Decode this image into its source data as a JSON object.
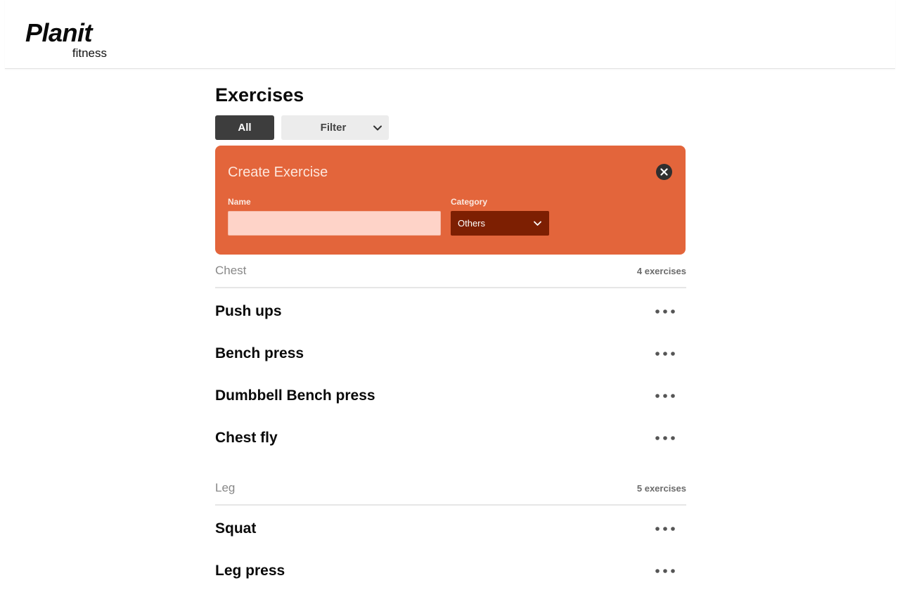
{
  "app": {
    "logo_main": "Planit",
    "logo_sub": "fitness"
  },
  "page": {
    "title": "Exercises"
  },
  "toolbar": {
    "all_label": "All",
    "filter_label": "Filter"
  },
  "create": {
    "title": "Create Exercise",
    "name_label": "Name",
    "name_value": "",
    "name_placeholder": "",
    "category_label": "Category",
    "category_value": "Others"
  },
  "groups": [
    {
      "name": "Chest",
      "count": "4 exercises",
      "exercises": [
        "Push ups",
        "Bench press",
        "Dumbbell Bench press",
        "Chest fly"
      ]
    },
    {
      "name": "Leg",
      "count": "5 exercises",
      "exercises": [
        "Squat",
        "Leg press"
      ]
    }
  ],
  "colors": {
    "accent": "#e3653b",
    "category_select": "#7d1f02",
    "name_input": "#fed3c8",
    "all_button": "#3d3d3d"
  },
  "icons": {
    "filter": "chevron-down-icon",
    "category": "chevron-down-icon",
    "close": "close-icon",
    "row_menu": "more-horizontal-icon"
  }
}
